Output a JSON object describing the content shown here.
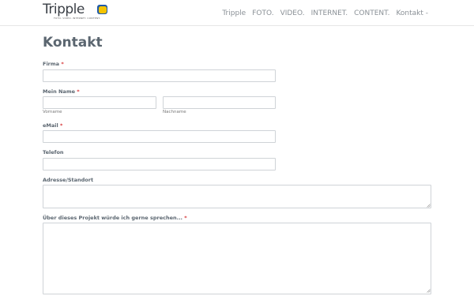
{
  "header": {
    "logo_text": "Tripple",
    "logo_tagline": "FOTO. VIDEO. INTERNET. CONTENT.",
    "nav": [
      "Tripple",
      "FOTO.",
      "VIDEO.",
      "INTERNET.",
      "CONTENT.",
      "Kontakt -"
    ]
  },
  "page": {
    "title": "Kontakt"
  },
  "form": {
    "firma": {
      "label": "Firma",
      "required": "*",
      "value": ""
    },
    "name": {
      "label": "Mein Name",
      "required": "*",
      "first_sublabel": "Vorname",
      "last_sublabel": "Nachname",
      "first_value": "",
      "last_value": ""
    },
    "email": {
      "label": "eMail",
      "required": "*",
      "value": ""
    },
    "telefon": {
      "label": "Telefon",
      "value": ""
    },
    "adresse": {
      "label": "Adresse/Standort",
      "value": ""
    },
    "projekt": {
      "label": "Über dieses Projekt würde ich gerne sprechen...",
      "required": "*",
      "value": ""
    }
  },
  "colors": {
    "accent_blue": "#1f5aa8",
    "accent_yellow": "#f5c400",
    "required_red": "#d63638",
    "title_gray": "#5b6670"
  }
}
